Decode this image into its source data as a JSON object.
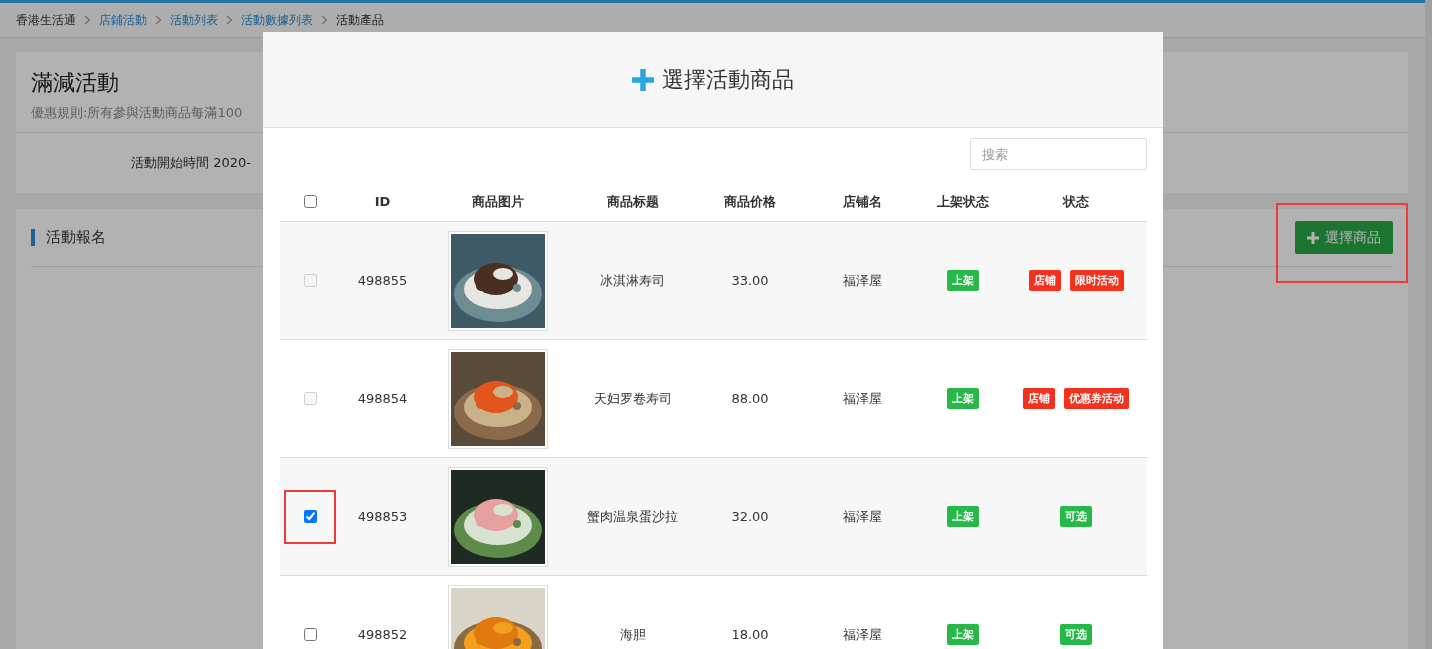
{
  "breadcrumb": [
    {
      "label": "香港生活通",
      "link": false
    },
    {
      "label": "店鋪活動",
      "link": true
    },
    {
      "label": "活動列表",
      "link": true
    },
    {
      "label": "活動數據列表",
      "link": true
    },
    {
      "label": "活動產品",
      "link": false
    }
  ],
  "activity": {
    "title": "滿減活動",
    "rule": "優惠規則:所有參與活動商品每滿100",
    "start_time": "活動開始時間 2020-"
  },
  "signup": {
    "title": "活動報名",
    "button": "選擇商品"
  },
  "modal": {
    "title": "選擇活動商品",
    "search": {
      "placeholder": "搜索"
    },
    "columns": [
      "ID",
      "商品图片",
      "商品标题",
      "商品价格",
      "店铺名",
      "上架状态",
      "状态"
    ],
    "header_checked": false,
    "rows": [
      {
        "checked": false,
        "disabled": true,
        "id": "498855",
        "picture": {
          "kind": "picture"
        },
        "title": "冰淇淋寿司",
        "price": "33.00",
        "store": "福泽屋",
        "shelf": "上架",
        "tags": [
          {
            "label": "店铺",
            "color": "#f0321e"
          },
          {
            "label": "限时活动",
            "color": "#f0321e"
          }
        ]
      },
      {
        "checked": false,
        "disabled": true,
        "id": "498854",
        "picture": {
          "kind": "picture"
        },
        "title": "天妇罗卷寿司",
        "price": "88.00",
        "store": "福泽屋",
        "shelf": "上架",
        "tags": [
          {
            "label": "店铺",
            "color": "#f0321e"
          },
          {
            "label": "优惠券活动",
            "color": "#f0321e"
          }
        ]
      },
      {
        "checked": true,
        "disabled": false,
        "id": "498853",
        "picture": {
          "kind": "picture"
        },
        "title": "蟹肉温泉蛋沙拉",
        "price": "32.00",
        "store": "福泽屋",
        "shelf": "上架",
        "tags": [
          {
            "label": "可选",
            "color": "#28b84a"
          }
        ]
      },
      {
        "checked": false,
        "disabled": false,
        "id": "498852",
        "picture": {
          "kind": "picture"
        },
        "title": "海胆",
        "price": "18.00",
        "store": "福泽屋",
        "shelf": "上架",
        "tags": [
          {
            "label": "可选",
            "color": "#28b84a"
          }
        ]
      }
    ]
  }
}
